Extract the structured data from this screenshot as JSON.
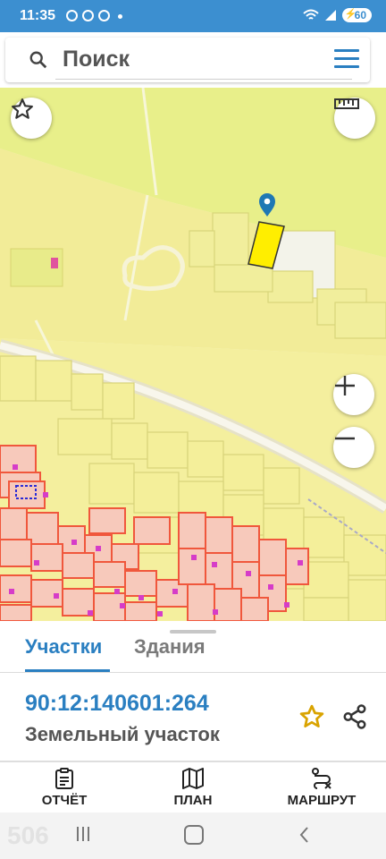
{
  "status_bar": {
    "time": "11:35",
    "battery": "60"
  },
  "search": {
    "placeholder": "Поиск"
  },
  "sheet": {
    "tabs": [
      {
        "label": "Участки"
      },
      {
        "label": "Здания"
      }
    ],
    "cadastral_number": "90:12:140601:264",
    "parcel_type": "Земельный участок"
  },
  "bottom_nav": {
    "report": "ОТЧЁТ",
    "plan": "ПЛАН",
    "route": "МАРШРУТ"
  },
  "system_bar": {
    "watermark": "506"
  },
  "colors": {
    "accent": "#2a7fc1",
    "status_bar": "#3c8fd0",
    "parcel_highlight": "#ffee00",
    "map_yellow": "#eef08a",
    "buildings": "#ff6a4d"
  }
}
